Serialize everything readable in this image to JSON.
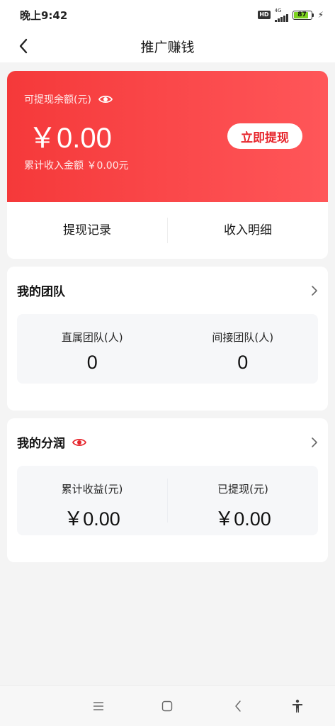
{
  "status_bar": {
    "time": "晚上9:42",
    "hd": "HD",
    "network": "4G",
    "battery": "87",
    "battery_level": 0.87
  },
  "header": {
    "title": "推广赚钱"
  },
  "balance": {
    "label": "可提现余额(元)",
    "amount": "￥0.00",
    "total_label": "累计收入金额 ￥0.00元",
    "withdraw_button": "立即提现",
    "accent_color": "#f5393a"
  },
  "links": {
    "withdraw_records": "提现记录",
    "income_details": "收入明细"
  },
  "team": {
    "title": "我的团队",
    "direct_label": "直属团队(人)",
    "direct_value": "0",
    "indirect_label": "间接团队(人)",
    "indirect_value": "0"
  },
  "profit": {
    "title": "我的分润",
    "total_label": "累计收益(元)",
    "total_value": "￥0.00",
    "withdrawn_label": "已提现(元)",
    "withdrawn_value": "￥0.00"
  },
  "icons": {
    "back": "back-arrow-icon",
    "eye": "eye-icon",
    "chevron": "chevron-right-icon",
    "menu": "menu-icon",
    "home": "home-icon",
    "nav_back": "nav-back-icon",
    "accessibility": "accessibility-icon"
  }
}
